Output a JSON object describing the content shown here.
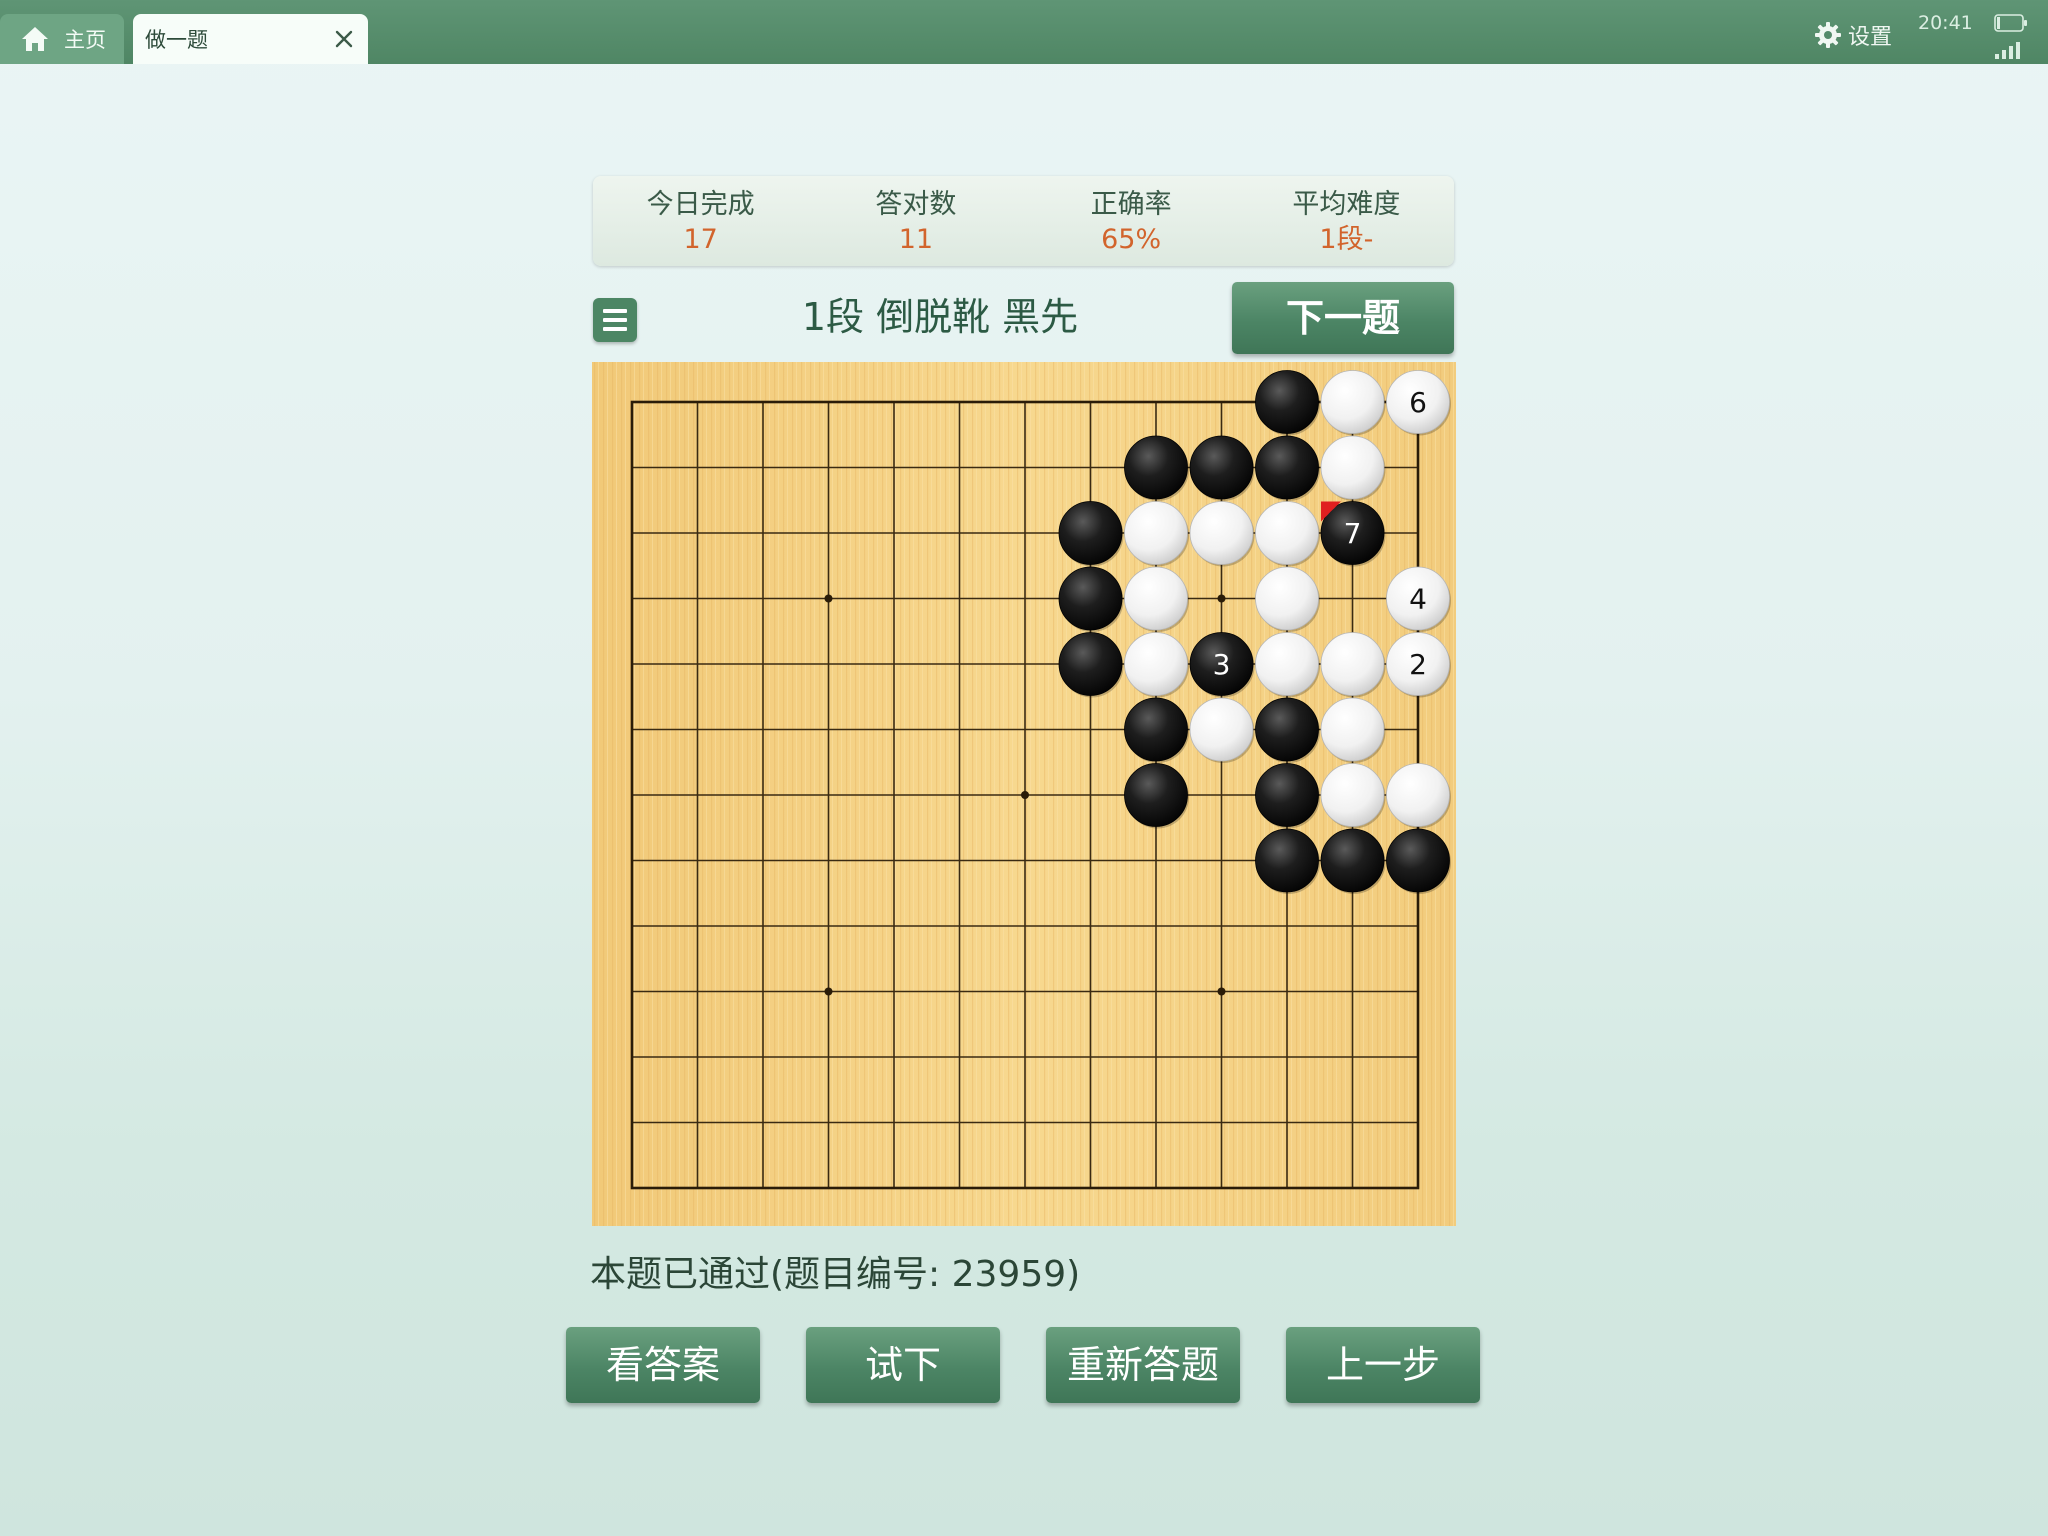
{
  "tabs": {
    "home_label": "主页",
    "active_label": "做一题",
    "home_icon": "home-icon",
    "close_icon": "close-icon"
  },
  "status_bar": {
    "settings_label": "设置",
    "time": "20:41"
  },
  "stats": [
    {
      "label": "今日完成",
      "value": "17"
    },
    {
      "label": "答对数",
      "value": "11"
    },
    {
      "label": "正确率",
      "value": "65%"
    },
    {
      "label": "平均难度",
      "value": "1段-"
    }
  ],
  "problem": {
    "title": "1段 倒脱靴 黑先",
    "next_label": "下一题",
    "status": "本题已通过(题目编号: 23959)"
  },
  "board": {
    "size": 13,
    "star_points": [
      [
        3,
        3
      ],
      [
        9,
        3
      ],
      [
        6,
        6
      ],
      [
        3,
        9
      ],
      [
        9,
        9
      ]
    ],
    "stones": [
      {
        "c": "b",
        "x": 10,
        "y": 0
      },
      {
        "c": "w",
        "x": 11,
        "y": 0
      },
      {
        "c": "w",
        "x": 12,
        "y": 0,
        "n": "6"
      },
      {
        "c": "b",
        "x": 8,
        "y": 1
      },
      {
        "c": "b",
        "x": 9,
        "y": 1
      },
      {
        "c": "b",
        "x": 10,
        "y": 1
      },
      {
        "c": "w",
        "x": 11,
        "y": 1
      },
      {
        "c": "b",
        "x": 7,
        "y": 2
      },
      {
        "c": "w",
        "x": 8,
        "y": 2
      },
      {
        "c": "w",
        "x": 9,
        "y": 2
      },
      {
        "c": "w",
        "x": 10,
        "y": 2
      },
      {
        "c": "b",
        "x": 11,
        "y": 2,
        "n": "7",
        "last": true
      },
      {
        "c": "b",
        "x": 7,
        "y": 3
      },
      {
        "c": "w",
        "x": 8,
        "y": 3
      },
      {
        "c": "w",
        "x": 10,
        "y": 3
      },
      {
        "c": "w",
        "x": 12,
        "y": 3,
        "n": "4"
      },
      {
        "c": "b",
        "x": 7,
        "y": 4
      },
      {
        "c": "w",
        "x": 8,
        "y": 4
      },
      {
        "c": "b",
        "x": 9,
        "y": 4,
        "n": "3"
      },
      {
        "c": "w",
        "x": 10,
        "y": 4
      },
      {
        "c": "w",
        "x": 11,
        "y": 4
      },
      {
        "c": "w",
        "x": 12,
        "y": 4,
        "n": "2"
      },
      {
        "c": "b",
        "x": 8,
        "y": 5
      },
      {
        "c": "w",
        "x": 9,
        "y": 5
      },
      {
        "c": "b",
        "x": 10,
        "y": 5
      },
      {
        "c": "w",
        "x": 11,
        "y": 5
      },
      {
        "c": "b",
        "x": 8,
        "y": 6
      },
      {
        "c": "b",
        "x": 10,
        "y": 6
      },
      {
        "c": "w",
        "x": 11,
        "y": 6
      },
      {
        "c": "w",
        "x": 12,
        "y": 6
      },
      {
        "c": "b",
        "x": 10,
        "y": 7
      },
      {
        "c": "b",
        "x": 11,
        "y": 7
      },
      {
        "c": "b",
        "x": 12,
        "y": 7
      }
    ]
  },
  "buttons": {
    "answer": "看答案",
    "try": "试下",
    "restart": "重新答题",
    "back": "上一步"
  },
  "colors": {
    "accent_green": "#4c8565",
    "stat_value_orange": "#d2642c",
    "last_move_marker": "#e02020"
  }
}
